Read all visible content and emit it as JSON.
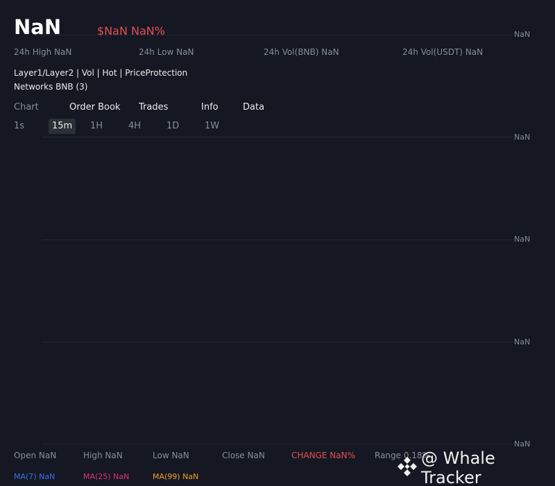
{
  "header": {
    "price": "NaN",
    "price_usd_change": "$NaN NaN%"
  },
  "stats": [
    {
      "label": "24h High NaN"
    },
    {
      "label": "24h Low NaN"
    },
    {
      "label": "24h Vol(BNB) NaN"
    },
    {
      "label": "24h Vol(USDT) NaN"
    }
  ],
  "tags": "Layer1/Layer2 | Vol | Hot | PriceProtection",
  "networks": "Networks BNB (3)",
  "tabs": [
    {
      "label": "Chart",
      "active": false
    },
    {
      "label": "Order Book"
    },
    {
      "label": "Trades"
    },
    {
      "label": "Info"
    },
    {
      "label": "Data"
    }
  ],
  "intervals": [
    {
      "label": "1s"
    },
    {
      "label": "15m",
      "active": true
    },
    {
      "label": "1H"
    },
    {
      "label": "4H"
    },
    {
      "label": "1D"
    },
    {
      "label": "1W"
    }
  ],
  "y_axis_labels": [
    "NaN",
    "NaN",
    "NaN",
    "NaN",
    "NaN"
  ],
  "ohlc": {
    "open": "Open NaN",
    "high": "High NaN",
    "low": "Low NaN",
    "close": "Close NaN",
    "change": "CHANGE NaN%",
    "range": "Range 0.18%"
  },
  "ma": {
    "ma7": "MA(7) NaN",
    "ma25": "MA(25) NaN",
    "ma99": "MA(99) NaN"
  },
  "colors": {
    "background": "#151822",
    "negative": "#e74d54",
    "ma7": "#3b6ef5",
    "ma25": "#e0317a",
    "ma99": "#f0a02c",
    "muted": "#848e9c"
  },
  "watermark": {
    "text": "@ Whale Tracker",
    "icon": "binance-logo-icon"
  }
}
